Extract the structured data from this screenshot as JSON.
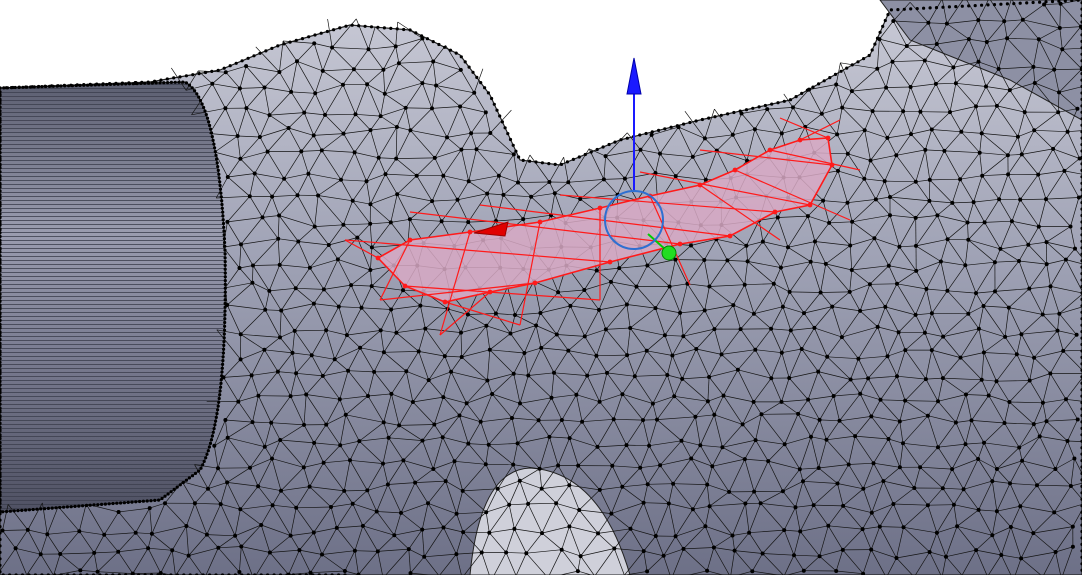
{
  "app": {
    "name": "",
    "view": "3d-viewport"
  },
  "colors": {
    "background": "#ffffff",
    "mesh_fill": "#9fa2b5",
    "mesh_wire": "#141414",
    "vertex": "#000000",
    "selection_edge": "#ff1a1a",
    "selection_face": "#d8a9c4",
    "gizmo_z": "#1a1aff",
    "gizmo_x": "#ff0000",
    "gizmo_y": "#00cc00",
    "pivot_circle": "#2e6fd1"
  },
  "gizmo": {
    "axes": [
      "z-arrow",
      "x-arrow",
      "y-handle"
    ],
    "pivot": "pivot-circle"
  },
  "selection": {
    "mode": "face",
    "label": ""
  }
}
